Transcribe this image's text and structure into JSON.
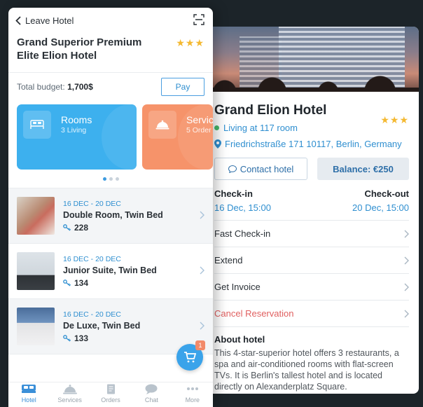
{
  "left": {
    "back_label": "Leave Hotel",
    "hotel_title": "Grand Superior Premium Elite Elion Hotel",
    "stars": "★★★",
    "budget_label": "Total budget:",
    "budget_value": "1,700$",
    "pay_label": "Pay",
    "cards": [
      {
        "title": "Rooms",
        "subtitle": "3 Living",
        "color": "#3db0ee"
      },
      {
        "title": "Servic",
        "subtitle": "5 Order",
        "color": "#f6936a"
      }
    ],
    "bookings": [
      {
        "dates": "16 DEC - 20 DEC",
        "room": "Double Room, Twin Bed",
        "key": "228"
      },
      {
        "dates": "16 DEC - 20 DEC",
        "room": "Junior Suite, Twin Bed",
        "key": "134"
      },
      {
        "dates": "16 DEC - 20 DEC",
        "room": "De Luxe, Twin Bed",
        "key": "133"
      }
    ],
    "cart_badge": "1",
    "tabs": [
      {
        "label": "Hotel",
        "icon": "bed-icon"
      },
      {
        "label": "Services",
        "icon": "cloche-icon"
      },
      {
        "label": "Orders",
        "icon": "document-icon"
      },
      {
        "label": "Chat",
        "icon": "chat-bubble-icon"
      },
      {
        "label": "More",
        "icon": "more-dots-icon"
      }
    ]
  },
  "right": {
    "hotel_title": "Grand Elion Hotel",
    "stars": "★★★",
    "living": "Living at 117 room",
    "address": "Friedrichstraße 171 10117, Berlin, Germany",
    "contact_label": "Contact hotel",
    "balance_label": "Balance: €250",
    "checkin_label": "Check-in",
    "checkin_value": "16 Dec, 15:00",
    "checkout_label": "Check-out",
    "checkout_value": "20 Dec, 15:00",
    "menu": [
      "Fast Check-in",
      "Extend",
      "Get Invoice",
      "Cancel Reservation"
    ],
    "about_heading": "About hotel",
    "about_text": "This 4-star-superior hotel offers 3 restaurants, a spa and air-conditioned rooms with flat-screen TVs. It is Berlin's tallest hotel and is located directly on Alexanderplatz Square."
  },
  "colors": {
    "accent": "#2f8fd0",
    "stars": "#f4b932",
    "danger": "#e06060",
    "rooms_card": "#3db0ee",
    "services_card": "#f6936a"
  }
}
